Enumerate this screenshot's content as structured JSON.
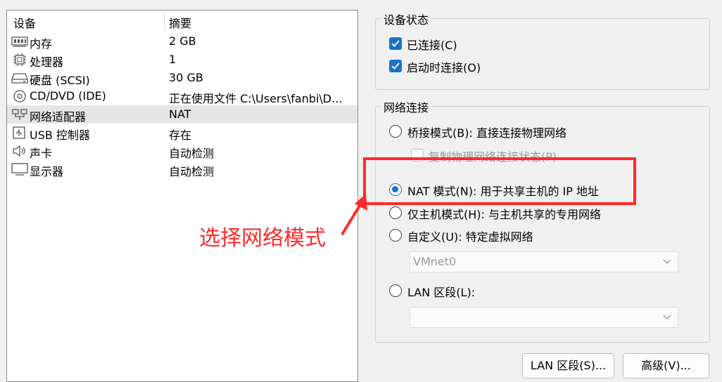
{
  "device_list": {
    "header": {
      "device": "设备",
      "summary": "摘要"
    },
    "items": [
      {
        "icon": "memory-icon",
        "name": "内存",
        "summary": "2 GB"
      },
      {
        "icon": "processor-icon",
        "name": "处理器",
        "summary": "1"
      },
      {
        "icon": "hard-disk-icon",
        "name": "硬盘 (SCSI)",
        "summary": "30 GB"
      },
      {
        "icon": "cd-dvd-icon",
        "name": "CD/DVD (IDE)",
        "summary": "正在使用文件 C:\\Users\\fanbi\\D..."
      },
      {
        "icon": "network-adapter-icon",
        "name": "网络适配器",
        "summary": "NAT"
      },
      {
        "icon": "usb-icon",
        "name": "USB 控制器",
        "summary": "存在"
      },
      {
        "icon": "sound-icon",
        "name": "声卡",
        "summary": "自动检测"
      },
      {
        "icon": "display-icon",
        "name": "显示器",
        "summary": "自动检测"
      }
    ],
    "selected_index": 4
  },
  "device_status": {
    "title": "设备状态",
    "connected": {
      "label": "已连接(C)",
      "checked": true
    },
    "connect_at_power_on": {
      "label": "启动时连接(O)",
      "checked": true
    }
  },
  "network_connection": {
    "title": "网络连接",
    "bridged": {
      "label": "桥接模式(B): 直接连接物理网络",
      "selected": false
    },
    "replicate": {
      "label": "复制物理网络连接状态(P)",
      "checked": false
    },
    "nat": {
      "label": "NAT 模式(N): 用于共享主机的 IP 地址",
      "selected": true
    },
    "host_only": {
      "label": "仅主机模式(H): 与主机共享的专用网络",
      "selected": false
    },
    "custom": {
      "label": "自定义(U): 特定虚拟网络",
      "selected": false
    },
    "vmnet_value": "VMnet0",
    "lan_segment": {
      "label": "LAN 区段(L):",
      "selected": false
    },
    "lan_value": ""
  },
  "buttons": {
    "lan_segments": "LAN 区段(S)...",
    "advanced": "高级(V)..."
  },
  "annotation": {
    "text": "选择网络模式",
    "color": "#ff2a2a"
  },
  "colors": {
    "accent": "#1a73c6",
    "selected_row": "#e5e5e5"
  }
}
